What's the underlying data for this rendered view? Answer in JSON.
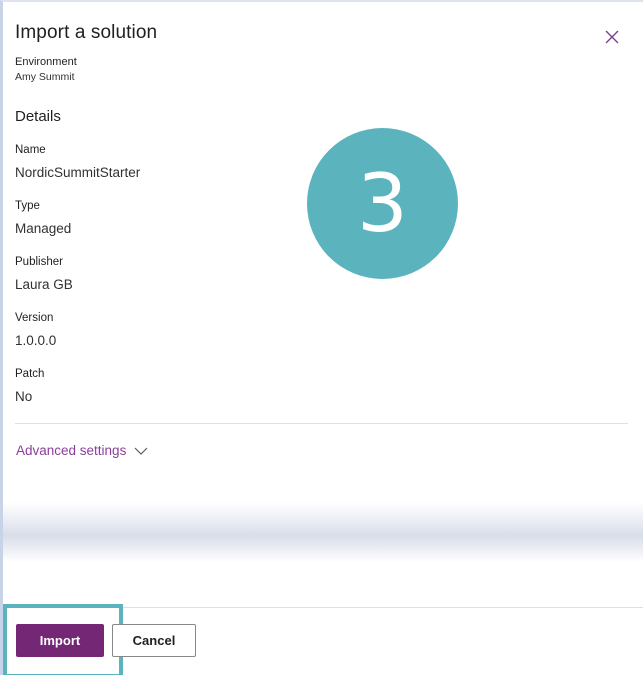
{
  "dialog": {
    "title": "Import a solution",
    "environment_label": "Environment",
    "environment_value": "Amy Summit",
    "details_heading": "Details",
    "fields": [
      {
        "label": "Name",
        "value": "NordicSummitStarter"
      },
      {
        "label": "Type",
        "value": "Managed"
      },
      {
        "label": "Publisher",
        "value": "Laura GB"
      },
      {
        "label": "Version",
        "value": "1.0.0.0"
      },
      {
        "label": "Patch",
        "value": "No"
      }
    ],
    "advanced_settings": "Advanced settings",
    "close_icon": "close-icon",
    "chevron_icon": "chevron-down-icon"
  },
  "step_badge": "3",
  "footer": {
    "import_label": "Import",
    "cancel_label": "Cancel"
  },
  "colors": {
    "accent": "#742774",
    "link": "#8a3e9c",
    "badge": "#5bb3bd",
    "highlight": "#5bb3bd"
  }
}
